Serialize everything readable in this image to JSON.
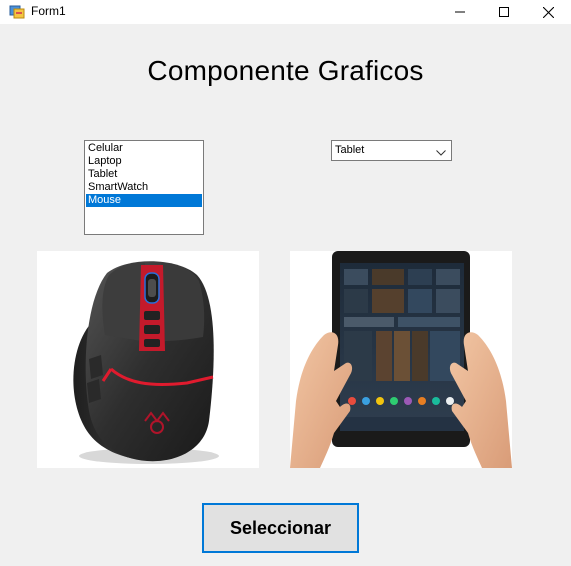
{
  "window": {
    "title": "Form1",
    "icons": {
      "app": "form-app-icon",
      "minimize": "minimize-icon",
      "maximize": "maximize-icon",
      "close": "close-icon"
    }
  },
  "main": {
    "heading": "Componente Graficos",
    "listbox": {
      "items": [
        "Celular",
        "Laptop",
        "Tablet",
        "SmartWatch",
        "Mouse"
      ],
      "selected_index": 4
    },
    "combo": {
      "value": "Tablet",
      "icon": "chevron-down-icon"
    },
    "pictures": [
      {
        "subject": "gaming-mouse-image"
      },
      {
        "subject": "tablet-in-hands-image"
      }
    ],
    "button_label": "Seleccionar"
  },
  "colors": {
    "selection": "#0078d7",
    "window_bg": "#f0f0f0",
    "button_bg": "#e1e1e1",
    "button_border": "#0078d7"
  }
}
